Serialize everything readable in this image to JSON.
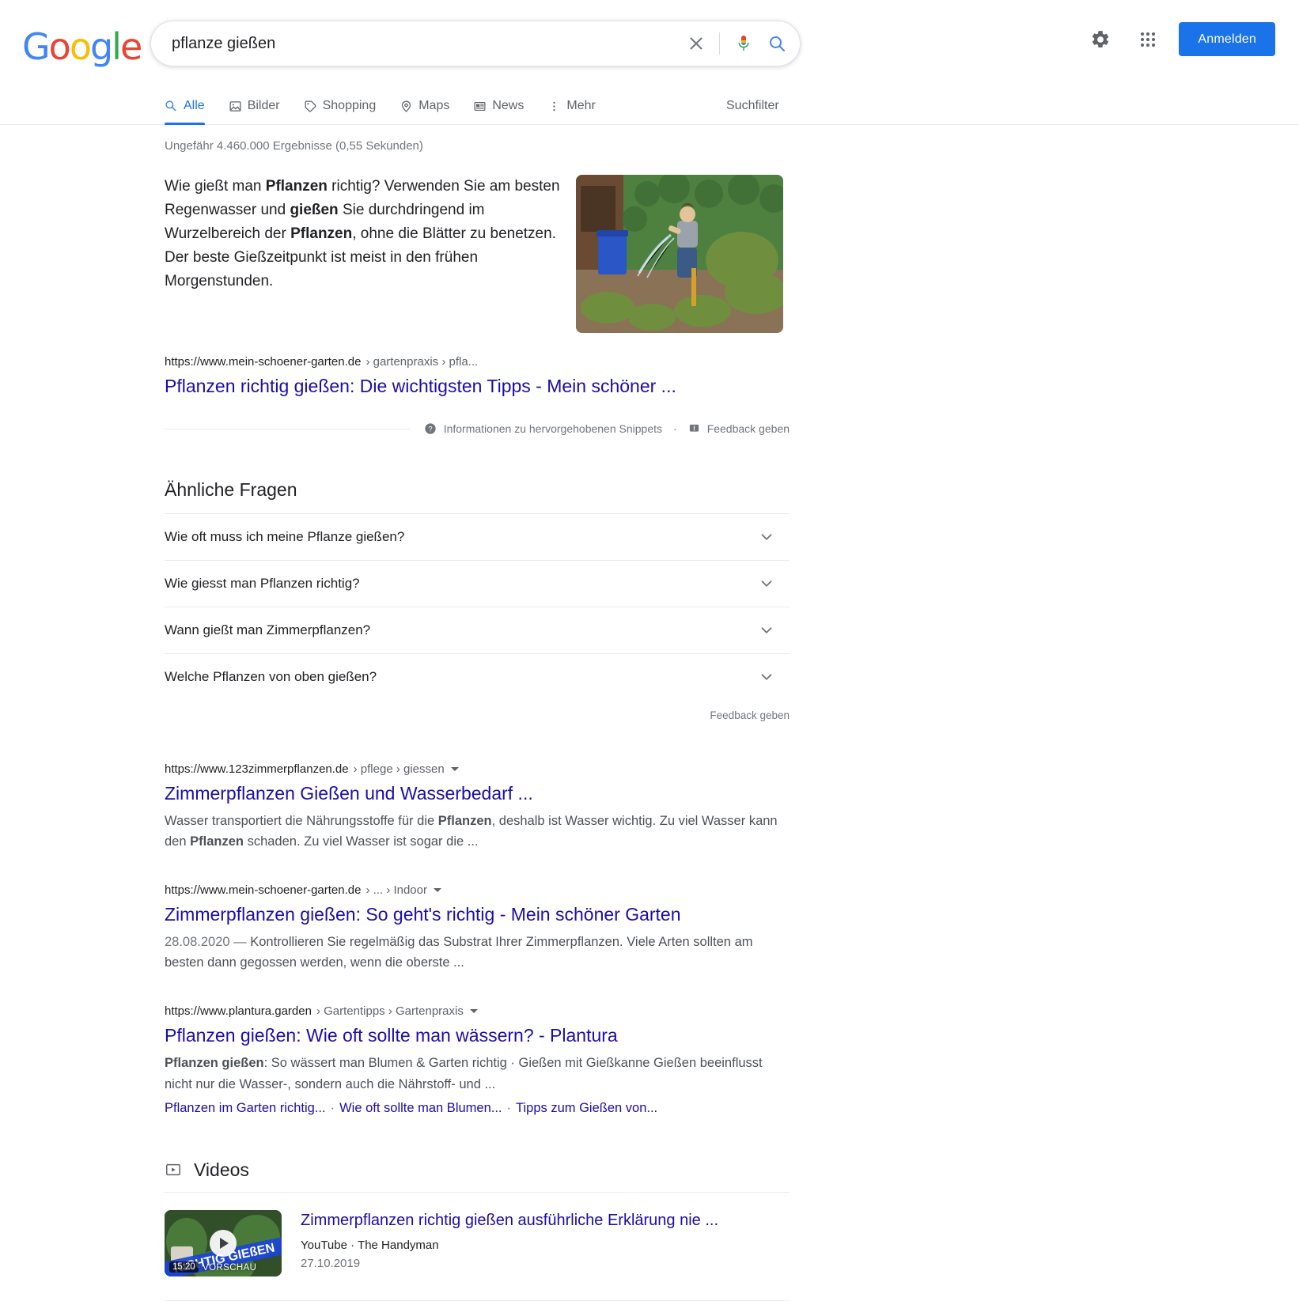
{
  "header": {
    "logo_letters": [
      "G",
      "o",
      "o",
      "g",
      "l",
      "e"
    ],
    "search_value": "pflanze gießen",
    "search_placeholder": "Suche",
    "settings_label": "Einstellungen",
    "apps_label": "Google Apps",
    "signin_label": "Anmelden"
  },
  "nav": {
    "tabs": [
      {
        "label": "Alle",
        "icon": "search-icon",
        "active": true
      },
      {
        "label": "Bilder",
        "icon": "image-icon",
        "active": false
      },
      {
        "label": "Shopping",
        "icon": "tag-icon",
        "active": false
      },
      {
        "label": "Maps",
        "icon": "pin-icon",
        "active": false
      },
      {
        "label": "News",
        "icon": "news-icon",
        "active": false
      },
      {
        "label": "Mehr",
        "icon": "more-vertical-icon",
        "active": false
      }
    ],
    "tools_label": "Suchfilter"
  },
  "main": {
    "result_stats": "Ungefähr 4.460.000 Ergebnisse (0,55 Sekunden)",
    "featured_snippet": {
      "text_parts": [
        {
          "t": "Wie gießt man ",
          "b": false
        },
        {
          "t": "Pflanzen",
          "b": true
        },
        {
          "t": " richtig? Verwenden Sie am besten Regenwasser und ",
          "b": false
        },
        {
          "t": "gießen",
          "b": true
        },
        {
          "t": " Sie durchdringend im Wurzelbereich der ",
          "b": false
        },
        {
          "t": "Pflanzen",
          "b": true
        },
        {
          "t": ", ohne die Blätter zu benetzen. Der beste Gießzeitpunkt ist meist in den frühen Morgenstunden.",
          "b": false
        }
      ],
      "domain": "https://www.mein-schoener-garten.de",
      "breadcrumbs": "› gartenpraxis › pfla...",
      "title": "Pflanzen richtig gießen: Die wichtigsten Tipps - Mein schöner ...",
      "info_link": "Informationen zu hervorgehobenen Snippets",
      "separator": "·",
      "feedback_link": "Feedback geben",
      "image_alt": "Frau gießt Pflanzen im Garten mit Gartenschlauch"
    },
    "people_also_ask": {
      "heading": "Ähnliche Fragen",
      "questions": [
        "Wie oft muss ich meine Pflanze gießen?",
        "Wie giesst man Pflanzen richtig?",
        "Wann gießt man Zimmerpflanzen?",
        "Welche Pflanzen von oben gießen?"
      ],
      "feedback_label": "Feedback geben"
    },
    "results": [
      {
        "domain": "https://www.123zimmerpflanzen.de",
        "breadcrumbs": "› pflege › giessen",
        "title": "Zimmerpflanzen Gießen und Wasserbedarf ...",
        "date": "",
        "desc_parts": [
          {
            "t": "Wasser transportiert die Nährungsstoffe für die ",
            "b": false
          },
          {
            "t": "Pflanzen",
            "b": true
          },
          {
            "t": ", deshalb ist Wasser wichtig. Zu viel Wasser kann den ",
            "b": false
          },
          {
            "t": "Pflanzen",
            "b": true
          },
          {
            "t": " schaden. Zu viel Wasser ist sogar die ...",
            "b": false
          }
        ],
        "sitelinks": []
      },
      {
        "domain": "https://www.mein-schoener-garten.de",
        "breadcrumbs": "› ... › Indoor",
        "title": "Zimmerpflanzen gießen: So geht's richtig - Mein schöner Garten",
        "date": "28.08.2020 — ",
        "desc_parts": [
          {
            "t": "Kontrollieren Sie regelmäßig das Substrat Ihrer Zimmerpflanzen. Viele Arten sollten am besten dann gegossen werden, wenn die oberste ...",
            "b": false
          }
        ],
        "sitelinks": []
      },
      {
        "domain": "https://www.plantura.garden",
        "breadcrumbs": "› Gartentipps › Gartenpraxis",
        "title": "Pflanzen gießen: Wie oft sollte man wässern? - Plantura",
        "date": "",
        "desc_parts": [
          {
            "t": "Pflanzen gießen",
            "b": true
          },
          {
            "t": ": So wässert man Blumen & Garten richtig · Gießen mit Gießkanne Gießen beeinflusst nicht nur die Wasser-, sondern auch die Nährstoff- und ...",
            "b": false
          }
        ],
        "sitelinks": [
          "Pflanzen im Garten richtig...",
          "Wie oft sollte man Blumen...",
          "Tipps zum Gießen von..."
        ]
      }
    ],
    "videos": {
      "heading": "Videos",
      "items": [
        {
          "title": "Zimmerpflanzen richtig gießen ausführliche Erklärung nie ...",
          "source": "YouTube",
          "separator": "·",
          "channel": "The Handyman",
          "date": "27.10.2019",
          "duration": "15:20",
          "preview_label": "VORSCHAU",
          "thumb_text": "RICHTIG GIEßEN"
        }
      ]
    }
  },
  "colors": {
    "link": "#1a0dab",
    "accent": "#1a73e8",
    "muted": "#70757a"
  }
}
